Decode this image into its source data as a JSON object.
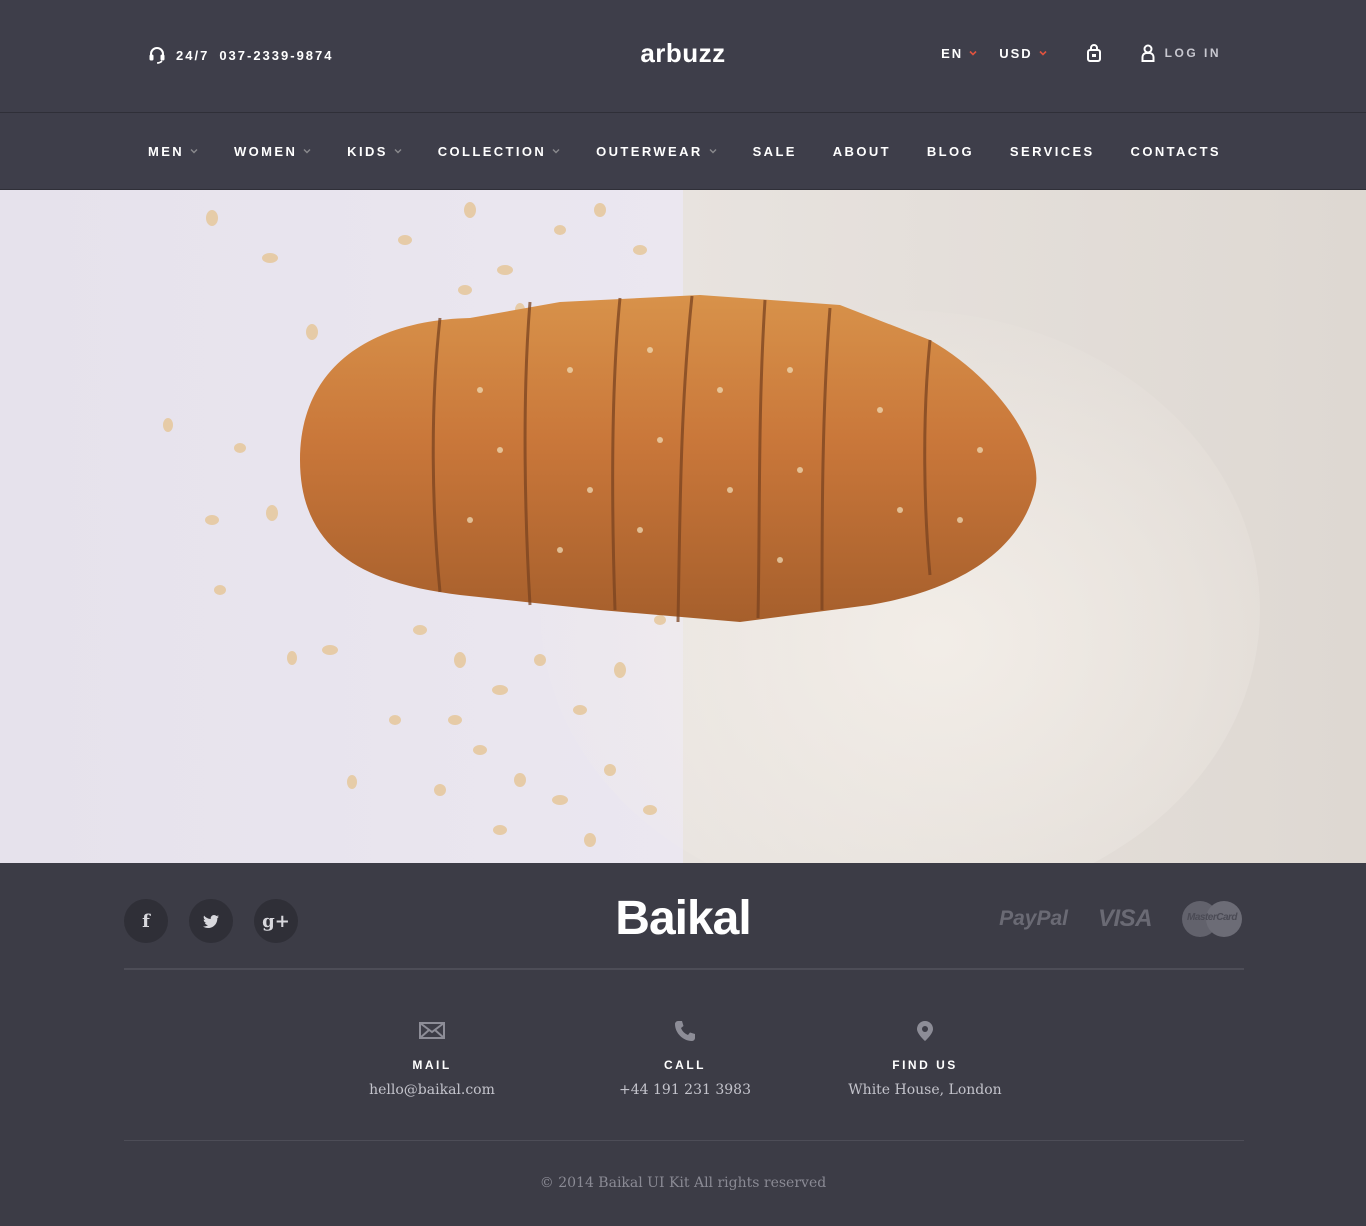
{
  "header": {
    "phone_hours": "24/7",
    "phone_number": "037-2339-9874",
    "logo": "arbuzz",
    "language": "EN",
    "currency": "USD",
    "login_label": "LOG IN"
  },
  "nav": {
    "items": [
      {
        "label": "MEN"
      },
      {
        "label": "WOMEN"
      },
      {
        "label": "KIDS"
      },
      {
        "label": "COLLECTION"
      },
      {
        "label": "OUTERWEAR"
      },
      {
        "label": "SALE"
      },
      {
        "label": "ABOUT"
      },
      {
        "label": "BLOG"
      },
      {
        "label": "SERVICES"
      },
      {
        "label": "CONTACTS"
      }
    ]
  },
  "footer": {
    "brand": "Baikal",
    "social": {
      "facebook": "f",
      "google": "g+"
    },
    "payments": {
      "paypal": "PayPal",
      "visa": "VISA",
      "mastercard": "MasterCard"
    },
    "contacts": [
      {
        "label": "MAIL",
        "value": "hello@baikal.com",
        "icon": "mail-icon"
      },
      {
        "label": "CALL",
        "value": "+44 191 231 3983",
        "icon": "phone-icon"
      },
      {
        "label": "FIND US",
        "value": "White House, London",
        "icon": "location-pin-icon"
      }
    ],
    "copyright": "© 2014 Baikal UI Kit All rights reserved"
  },
  "colors": {
    "header_bg": "#3e3e4a",
    "footer_bg": "#3c3c46",
    "accent": "#e0533f"
  }
}
